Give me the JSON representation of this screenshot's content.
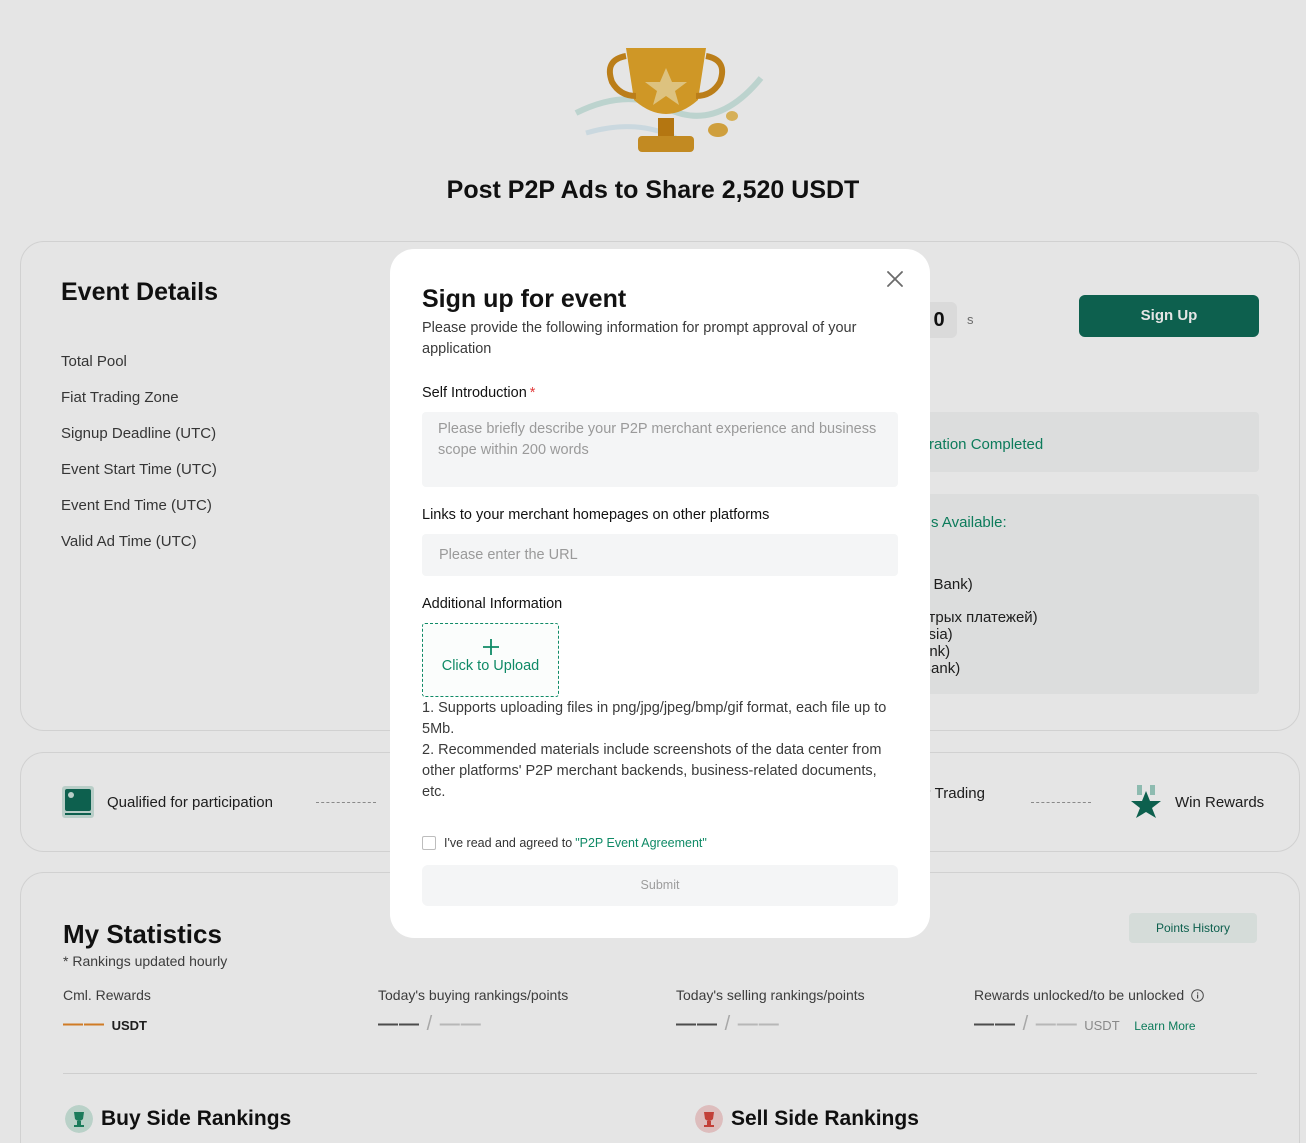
{
  "hero": {
    "title": "Post P2P Ads to Share 2,520 USDT",
    "image": "trophy-illustration"
  },
  "event_details": {
    "title": "Event Details",
    "labels": [
      "Total Pool",
      "Fiat Trading Zone",
      "Signup Deadline (UTC)",
      "Event Start Time (UTC)",
      "Event End Time (UTC)",
      "Valid Ad Time (UTC)"
    ],
    "countdown_digit": "0",
    "countdown_unit": "s",
    "signup_button": "Sign Up",
    "registration_text": "ration Completed",
    "available_heading": "s Available:",
    "available_items": [
      "e Bank)",
      "стрых платежей)",
      "ssia)",
      "ank)",
      "Bank)"
    ]
  },
  "steps": {
    "step1": "Qualified for participation",
    "step3": "P Trading",
    "step4": "Win Rewards"
  },
  "statistics": {
    "title": "My Statistics",
    "note": "* Rankings updated hourly",
    "points_history": "Points History",
    "columns": {
      "cml_rewards": "Cml. Rewards",
      "buying": "Today's buying rankings/points",
      "selling": "Today's selling rankings/points",
      "rewards_unlocked": "Rewards unlocked/to be unlocked"
    },
    "placeholder": "——",
    "slash": "/",
    "usdt": "USDT",
    "learn_more": "Learn More",
    "buy_rankings": "Buy Side Rankings",
    "sell_rankings": "Sell Side Rankings"
  },
  "modal": {
    "title": "Sign up for event",
    "subtitle": "Please provide the following information for prompt approval of your application",
    "self_intro_label": "Self Introduction",
    "required_mark": "*",
    "self_intro_placeholder": "Please briefly describe your P2P merchant experience and business scope within 200 words",
    "links_label": "Links to your merchant homepages on other platforms",
    "url_placeholder": "Please enter the URL",
    "additional_label": "Additional Information",
    "upload_text": "Click to Upload",
    "note1": "1. Supports uploading files in png/jpg/jpeg/bmp/gif format, each file up to 5Mb.",
    "note2": "2. Recommended materials include screenshots of the data center from other platforms' P2P merchant backends, business-related documents, etc.",
    "agree_text": "I've read and agreed to",
    "agree_link": "\"P2P Event Agreement\"",
    "submit": "Submit"
  },
  "colors": {
    "brand": "#0f6b57",
    "accent": "#0f8a66",
    "orange": "#e88a2a"
  }
}
